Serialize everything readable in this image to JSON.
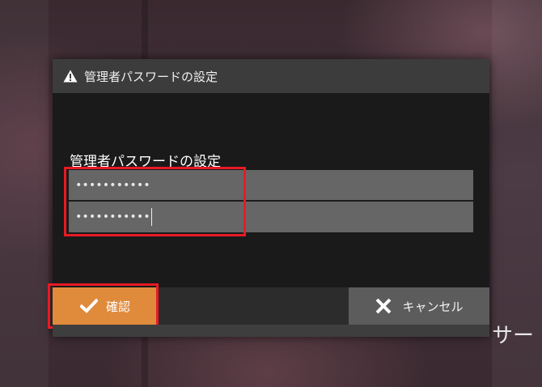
{
  "background": {
    "partial_text": "サー"
  },
  "dialog": {
    "title": "管理者パスワードの設定",
    "title_icon": "warning-icon",
    "field_label": "管理者パスワードの設定",
    "password_field": {
      "masked_value": "•••••••••••"
    },
    "confirm_field": {
      "masked_value": "•••••••••••"
    },
    "confirm_button": {
      "label": "確認",
      "icon": "checkmark-icon"
    },
    "cancel_button": {
      "label": "キャンセル",
      "icon": "close-icon"
    }
  },
  "colors": {
    "accent_orange": "#e08a3c",
    "highlight_red": "#e81a24",
    "input_bg": "#666666",
    "titlebar_bg": "#3c3c3c"
  }
}
